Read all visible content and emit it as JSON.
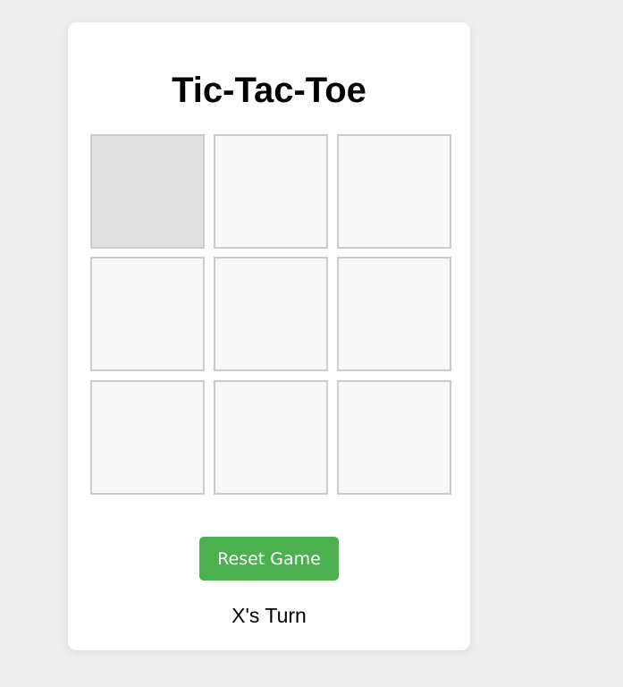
{
  "game": {
    "title": "Tic-Tac-Toe",
    "board": [
      "",
      "",
      "",
      "",
      "",
      "",
      "",
      "",
      ""
    ],
    "hovered_cell": 0,
    "reset_label": "Reset Game",
    "status": "X's Turn"
  },
  "colors": {
    "background": "#efefef",
    "card": "#ffffff",
    "cell": "#f8f8f8",
    "cell_hover": "#e0e0e0",
    "cell_border": "#cccccc",
    "button": "#4caf50",
    "button_text": "#ffffff"
  }
}
